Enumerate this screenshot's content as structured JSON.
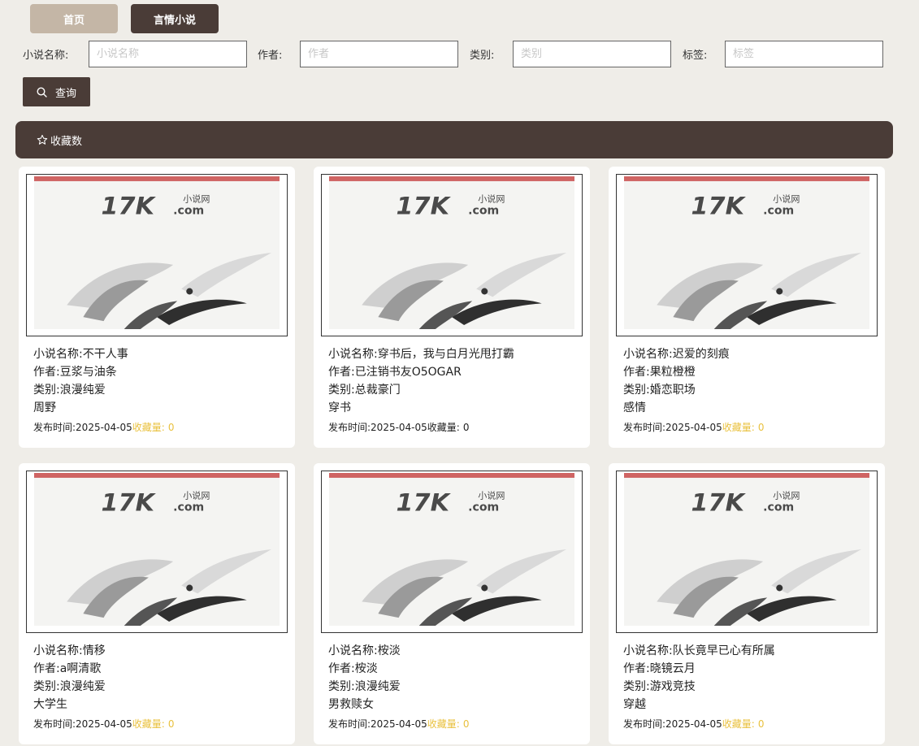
{
  "nav": {
    "tabs": [
      {
        "label": "首页"
      },
      {
        "label": "言情小说"
      }
    ]
  },
  "filters": [
    {
      "label": "小说名称:",
      "placeholder": "小说名称"
    },
    {
      "label": "作者:",
      "placeholder": "作者"
    },
    {
      "label": "类别:",
      "placeholder": "类别"
    },
    {
      "label": "标签:",
      "placeholder": "标签"
    }
  ],
  "search_button": {
    "label": "查询",
    "icon": "search-icon"
  },
  "sort_bar": {
    "label": "收藏数",
    "icon": "star-outline-icon"
  },
  "cover": {
    "logo_main": "17K",
    "logo_sub_top": "小说网",
    "logo_sub_bottom": ".com",
    "banner_color": "#c84a4a"
  },
  "colors": {
    "primary": "#4a3c37",
    "home_tab": "#c4b6a6",
    "favorite": "#e9c13e",
    "background": "#efede8"
  },
  "novels": [
    {
      "name": "小说名称:不干人事",
      "author": "作者:豆浆与油条",
      "category": "类别:浪漫纯爱",
      "tag": "周野",
      "date_label": "发布时间:",
      "date": "2025-04-05",
      "fav_label": "收藏量:",
      "fav_count": "0"
    },
    {
      "name": "小说名称:穿书后，我与白月光甩打霸",
      "author": "作者:已注销书友O5OGAR",
      "category": "类别:总裁豪门",
      "tag": "穿书",
      "date_label": "发布时间:",
      "date": "2025-04-05",
      "fav_label": "收藏量:",
      "fav_count": "0"
    },
    {
      "name": "小说名称:迟爱的刻痕",
      "author": "作者:果粒橙橙",
      "category": "类别:婚恋职场",
      "tag": "感情",
      "date_label": "发布时间:",
      "date": "2025-04-05",
      "fav_label": "收藏量:",
      "fav_count": "0"
    },
    {
      "name": "小说名称:情移",
      "author": "作者:a啊清歌",
      "category": "类别:浪漫纯爱",
      "tag": "大学生",
      "date_label": "发布时间:",
      "date": "2025-04-05",
      "fav_label": "收藏量:",
      "fav_count": "0"
    },
    {
      "name": "小说名称:桉淡",
      "author": "作者:桉淡",
      "category": "类别:浪漫纯爱",
      "tag": "男救赎女",
      "date_label": "发布时间:",
      "date": "2025-04-05",
      "fav_label": "收藏量:",
      "fav_count": "0"
    },
    {
      "name": "小说名称:队长竟早已心有所属",
      "author": "作者:晓镜云月",
      "category": "类别:游戏竞技",
      "tag": "穿越",
      "date_label": "发布时间:",
      "date": "2025-04-05",
      "fav_label": "收藏量:",
      "fav_count": "0"
    }
  ]
}
